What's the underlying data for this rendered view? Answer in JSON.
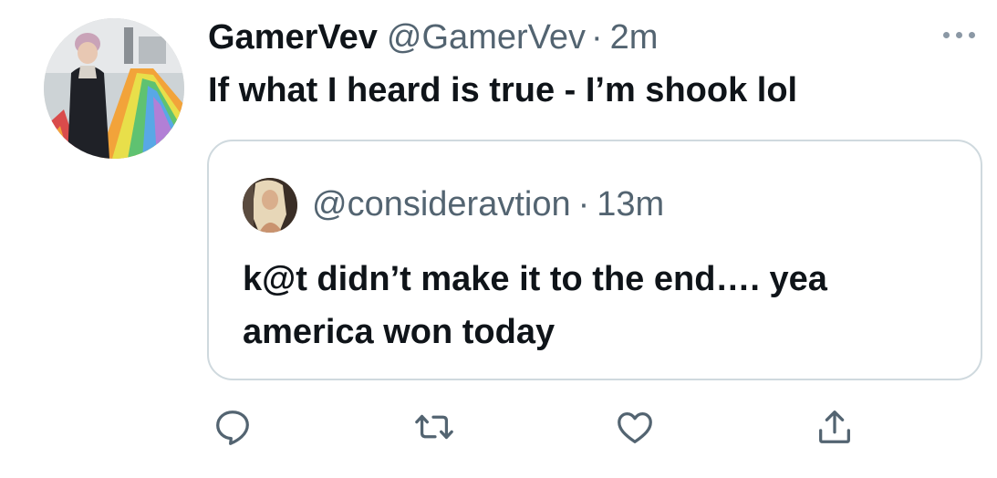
{
  "tweet": {
    "display_name": "GamerVev",
    "handle": "@GamerVev",
    "separator": "·",
    "time": "2m",
    "text": "If what I heard is true - I’m shook lol"
  },
  "quote": {
    "handle": "@consideravtion",
    "separator": "·",
    "time": "13m",
    "text": "k@t didn’t make it to the end…. yea america won today"
  },
  "actions": {
    "reply_icon": "reply-icon",
    "retweet_icon": "retweet-icon",
    "like_icon": "heart-icon",
    "share_icon": "share-icon"
  },
  "colors": {
    "text": "#0f1419",
    "secondary": "#536471",
    "border": "#cfd9de",
    "icon": "#536471"
  }
}
